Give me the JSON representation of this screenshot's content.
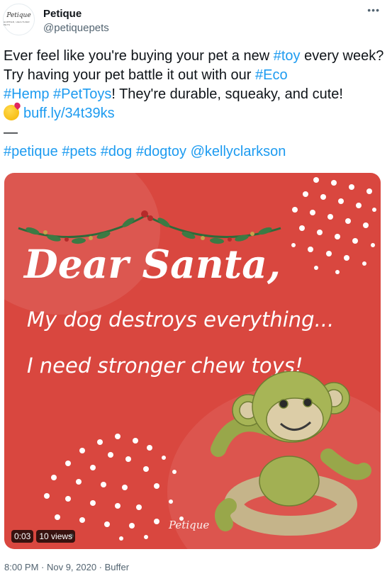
{
  "account": {
    "name": "Petique",
    "handle": "@petiquepets",
    "avatar_text": "Petique",
    "avatar_subtext": "HAPPIER, HEALTHIER PETS"
  },
  "menu_icon": "more-icon",
  "tweet": {
    "t1": "Ever feel like you're buying your pet a new ",
    "l1": "#toy",
    "t2": " every week? Try having your pet battle it out with our ",
    "l2": "#Eco",
    "t3": " ",
    "l3": "#Hemp",
    "t4": " ",
    "l4": "#PetToys",
    "t5": "! They're durable, squeaky, and cute!",
    "emoji": "kissing-face-emoji",
    "l5": "buff.ly/34t39ks",
    "divider": "—",
    "tags": [
      "#petique",
      "#pets",
      "#dog",
      "#dogtoy",
      "@kellyclarkson"
    ]
  },
  "media": {
    "headline": "Dear Santa,",
    "line1": "My dog destroys everything...",
    "line2": "I need stronger chew toys!",
    "watermark": "Petique",
    "time": "0:03",
    "views": "10 views"
  },
  "footer": "8:00 PM · Nov 9, 2020 · Buffer",
  "colors": {
    "link": "#1d9bf0",
    "media_bg": "#d9473f"
  }
}
